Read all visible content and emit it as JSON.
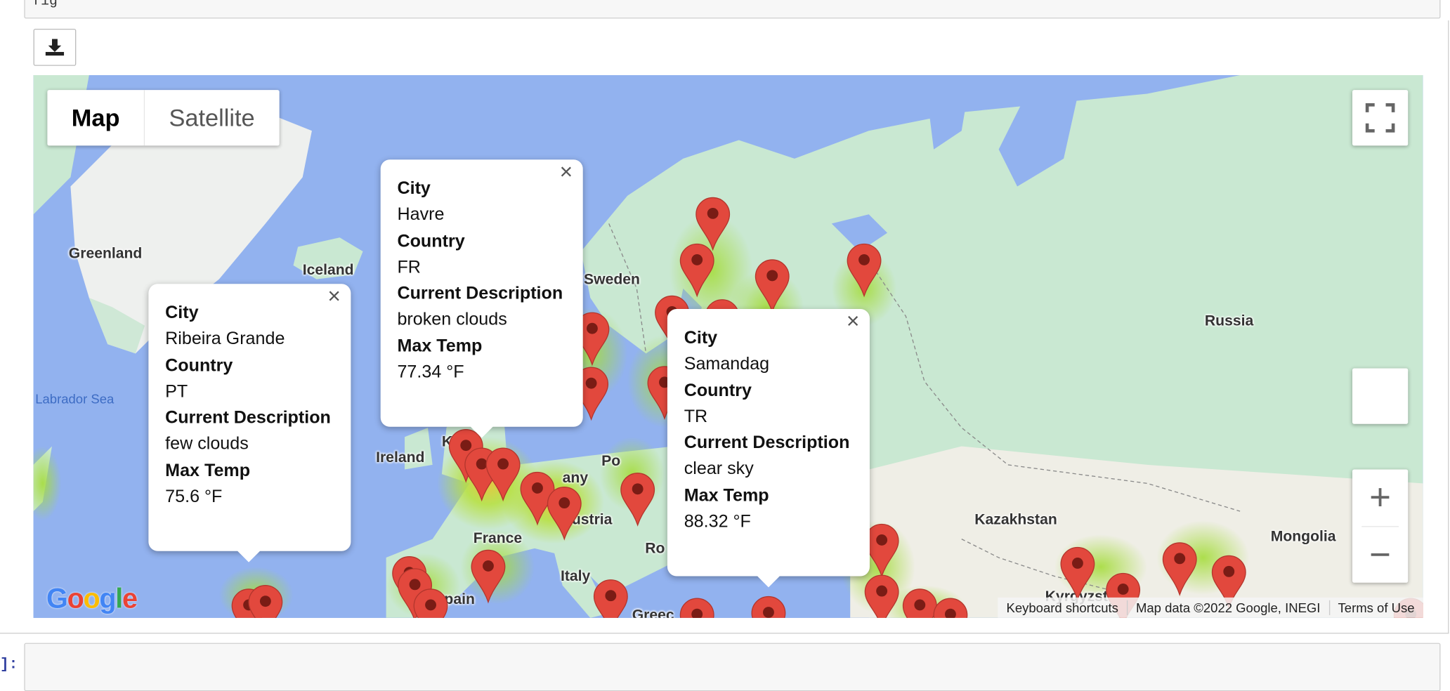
{
  "cell": {
    "code_fragment": "fig"
  },
  "output": {
    "download_icon": "download-icon"
  },
  "next_prompt": "]:",
  "map": {
    "type_control": {
      "map_label": "Map",
      "satellite_label": "Satellite"
    },
    "labels": {
      "greenland": "Greenland",
      "iceland": "Iceland",
      "labrador_sea": "Labrador Sea",
      "sweden": "Sweden",
      "russia": "Russia",
      "ireland": "Ireland",
      "kingdom_fragment": "K",
      "germany_fragment": "any",
      "poland_fragment": "Po",
      "france": "France",
      "austria_fragment": "ustria",
      "romania_fragment": "Ro",
      "italy": "Italy",
      "spain": "Spain",
      "kazakhstan": "Kazakhstan",
      "mongolia": "Mongolia",
      "kyrgyzstan": "Kyrgyzstan",
      "greece_fragment": "Greec"
    },
    "logo": "Google",
    "attribution": {
      "shortcuts": "Keyboard shortcuts",
      "map_data": "Map data ©2022 Google, INEGI",
      "terms": "Terms of Use"
    },
    "zoom": {
      "in": "+",
      "out": "−"
    }
  },
  "info_windows": [
    {
      "city_key": "City",
      "city": "Ribeira Grande",
      "country_key": "Country",
      "country": "PT",
      "desc_key": "Current Description",
      "desc": "few clouds",
      "temp_key": "Max Temp",
      "temp": "75.6 °F"
    },
    {
      "city_key": "City",
      "city": "Havre",
      "country_key": "Country",
      "country": "FR",
      "desc_key": "Current Description",
      "desc": "broken clouds",
      "temp_key": "Max Temp",
      "temp": "77.34 °F"
    },
    {
      "city_key": "City",
      "city": "Samandag",
      "country_key": "Country",
      "country": "TR",
      "desc_key": "Current Description",
      "desc": "clear sky",
      "temp_key": "Max Temp",
      "temp": "88.32 °F"
    }
  ],
  "close_symbol": "×",
  "colors": {
    "water": "#92b2ef",
    "land": "#c9e8d2",
    "pin": "#e2483d",
    "heat": "#a5dc3c"
  }
}
